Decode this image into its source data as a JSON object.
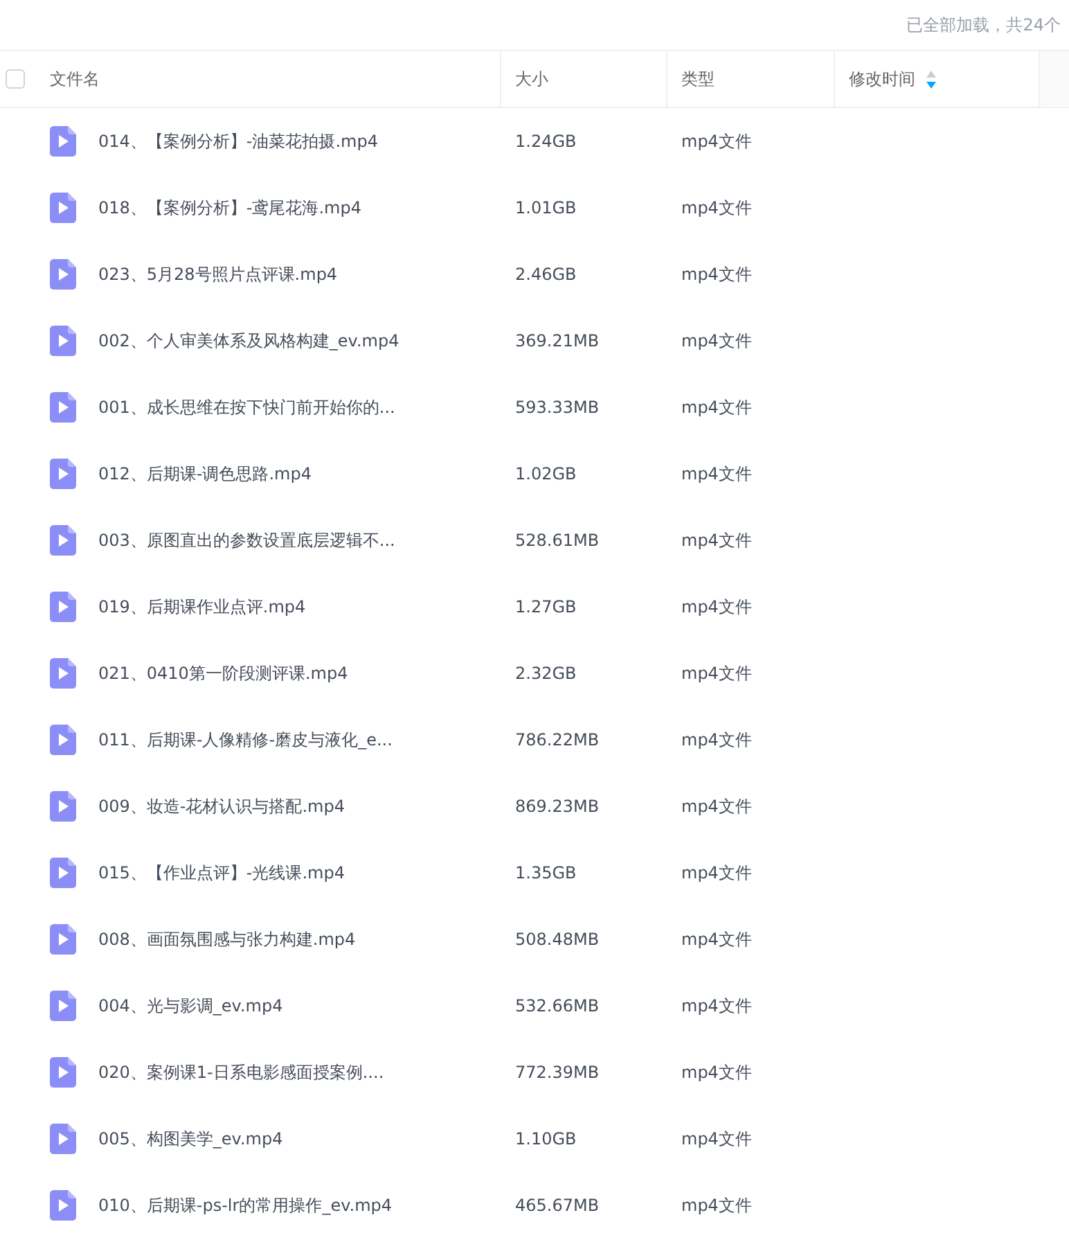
{
  "status_text": "已全部加载，共24个",
  "header": {
    "select_all_checked": false,
    "columns": [
      {
        "label": "文件名"
      },
      {
        "label": "大小"
      },
      {
        "label": "类型"
      },
      {
        "label": "修改时间",
        "sort_descending": true
      }
    ]
  },
  "files": [
    {
      "name": "014、【案例分析】-油菜花拍摄.mp4",
      "size": "1.24GB",
      "type": "mp4文件"
    },
    {
      "name": "018、【案例分析】-鸢尾花海.mp4",
      "size": "1.01GB",
      "type": "mp4文件"
    },
    {
      "name": "023、5月28号照片点评课.mp4",
      "size": "2.46GB",
      "type": "mp4文件"
    },
    {
      "name": "002、个人审美体系及风格构建_ev.mp4",
      "size": "369.21MB",
      "type": "mp4文件"
    },
    {
      "name": "001、成长思维在按下快门前开始你的...",
      "size": "593.33MB",
      "type": "mp4文件"
    },
    {
      "name": "012、后期课-调色思路.mp4",
      "size": "1.02GB",
      "type": "mp4文件"
    },
    {
      "name": "003、原图直出的参数设置底层逻辑不...",
      "size": "528.61MB",
      "type": "mp4文件"
    },
    {
      "name": "019、后期课作业点评.mp4",
      "size": "1.27GB",
      "type": "mp4文件"
    },
    {
      "name": "021、0410第一阶段测评课.mp4",
      "size": "2.32GB",
      "type": "mp4文件"
    },
    {
      "name": "011、后期课-人像精修-磨皮与液化_e...",
      "size": "786.22MB",
      "type": "mp4文件"
    },
    {
      "name": "009、妆造-花材认识与搭配.mp4",
      "size": "869.23MB",
      "type": "mp4文件"
    },
    {
      "name": "015、【作业点评】-光线课.mp4",
      "size": "1.35GB",
      "type": "mp4文件"
    },
    {
      "name": "008、画面氛围感与张力构建.mp4",
      "size": "508.48MB",
      "type": "mp4文件"
    },
    {
      "name": "004、光与影调_ev.mp4",
      "size": "532.66MB",
      "type": "mp4文件"
    },
    {
      "name": "020、案例课1-日系电影感面授案例....",
      "size": "772.39MB",
      "type": "mp4文件"
    },
    {
      "name": "005、构图美学_ev.mp4",
      "size": "1.10GB",
      "type": "mp4文件"
    },
    {
      "name": "010、后期课-ps-lr的常用操作_ev.mp4",
      "size": "465.67MB",
      "type": "mp4文件"
    }
  ]
}
